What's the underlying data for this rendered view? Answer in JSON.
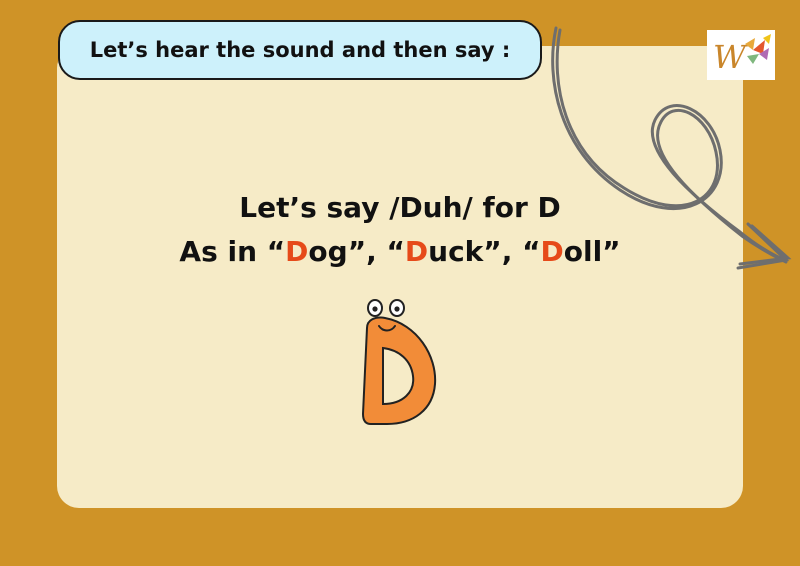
{
  "instruction": {
    "text": "Let’s hear the sound and then say :"
  },
  "headline": {
    "line1": "Let’s say /Duh/ for D",
    "line2": {
      "prefix": "As in “",
      "word1_letter": "D",
      "word1_rest": "og”, “",
      "word2_letter": "D",
      "word2_rest": "uck”, “",
      "word3_letter": "D",
      "word3_rest": "oll”"
    }
  },
  "logo": {
    "letter": "W"
  },
  "character": {
    "letter": "D",
    "color": "#F28C38"
  },
  "colors": {
    "background": "#CF9327",
    "card": "#F6EBC7",
    "instruction_bg": "#CDF1FB",
    "highlight": "#E64A19"
  }
}
